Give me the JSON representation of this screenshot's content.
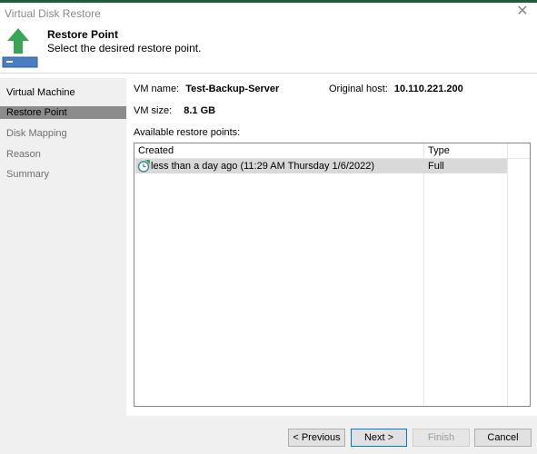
{
  "window": {
    "title": "Virtual Disk Restore"
  },
  "header": {
    "title": "Restore Point",
    "subtitle": "Select the desired restore point."
  },
  "sidebar": {
    "items": [
      {
        "label": "Virtual Machine",
        "state": "done"
      },
      {
        "label": "Restore Point",
        "state": "active"
      },
      {
        "label": "Disk Mapping",
        "state": "pending"
      },
      {
        "label": "Reason",
        "state": "pending"
      },
      {
        "label": "Summary",
        "state": "pending"
      }
    ]
  },
  "vm": {
    "name_label": "VM name:",
    "name_value": "Test-Backup-Server",
    "host_label": "Original host:",
    "host_value": "10.110.221.200",
    "size_label": "VM size:",
    "size_value": "8.1 GB"
  },
  "restore_points": {
    "label": "Available restore points:",
    "columns": [
      "Created",
      "Type"
    ],
    "rows": [
      {
        "created": "less than a day ago (11:29 AM Thursday 1/6/2022)",
        "type": "Full",
        "icon": "restore-point-clock-icon"
      }
    ]
  },
  "buttons": {
    "previous": "< Previous",
    "next": "Next >",
    "finish": "Finish",
    "cancel": "Cancel"
  },
  "colors": {
    "accent": "#1e5d3a",
    "arrow_green": "#3aa655",
    "selection": "#d9d9d9",
    "active_step": "#8c8c8c"
  }
}
